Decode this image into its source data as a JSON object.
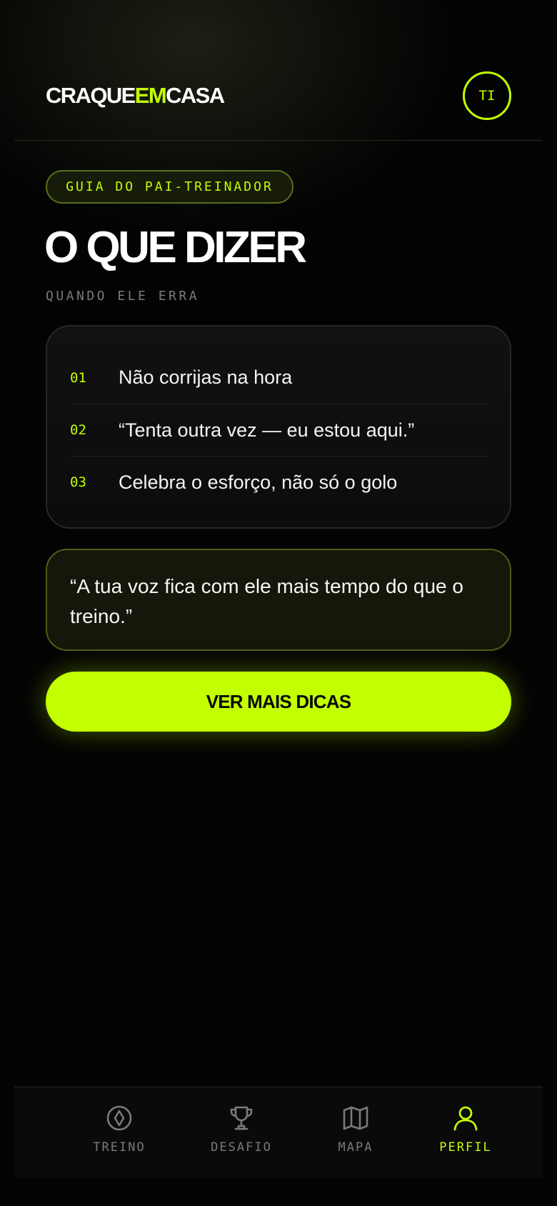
{
  "colors": {
    "accent": "#c2ff00",
    "background": "#030303",
    "muted": "#7a7a7a"
  },
  "header": {
    "logo": {
      "part1": "CRAQUE",
      "part2": "EM",
      "part3": "CASA"
    },
    "avatar_initials": "TI"
  },
  "main": {
    "pill": "GUIA DO PAI-TREINADOR",
    "title": "O QUE DIZER",
    "subtitle": "QUANDO ELE ERRA",
    "items": [
      {
        "num": "01",
        "text": "Não corrijas na hora"
      },
      {
        "num": "02",
        "text": "“Tenta outra vez — eu estou aqui.”"
      },
      {
        "num": "03",
        "text": "Celebra o esforço, não só o golo"
      }
    ],
    "quote": "“A tua voz fica com ele mais tempo do que o treino.”",
    "cta": "VER MAIS DICAS"
  },
  "nav": {
    "items": [
      {
        "label": "TREINO",
        "icon": "compass-icon",
        "active": false
      },
      {
        "label": "DESAFIO",
        "icon": "trophy-icon",
        "active": false
      },
      {
        "label": "MAPA",
        "icon": "map-icon",
        "active": false
      },
      {
        "label": "PERFIL",
        "icon": "user-icon",
        "active": true
      }
    ]
  }
}
